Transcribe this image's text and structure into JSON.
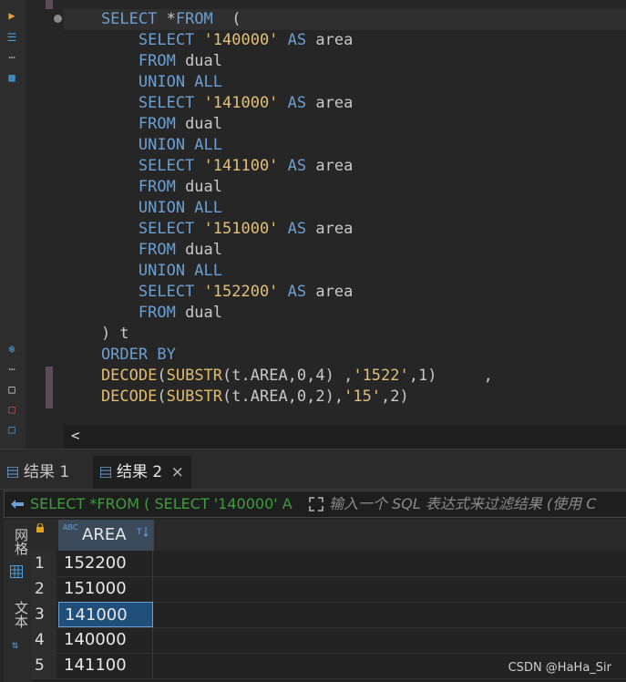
{
  "editor": {
    "lines": [
      [
        {
          "c": "kw",
          "t": "    SELECT "
        },
        {
          "c": "id",
          "t": "*"
        },
        {
          "c": "kw",
          "t": "FROM"
        },
        {
          "c": "id",
          "t": "  ("
        }
      ],
      [
        {
          "c": "kw",
          "t": "        SELECT "
        },
        {
          "c": "str",
          "t": "'140000'"
        },
        {
          "c": "kw",
          "t": " AS "
        },
        {
          "c": "id",
          "t": "area"
        }
      ],
      [
        {
          "c": "kw",
          "t": "        FROM "
        },
        {
          "c": "id",
          "t": "dual"
        }
      ],
      [
        {
          "c": "kw",
          "t": "        UNION ALL"
        }
      ],
      [
        {
          "c": "kw",
          "t": "        SELECT "
        },
        {
          "c": "str",
          "t": "'141000'"
        },
        {
          "c": "kw",
          "t": " AS "
        },
        {
          "c": "id",
          "t": "area"
        }
      ],
      [
        {
          "c": "kw",
          "t": "        FROM "
        },
        {
          "c": "id",
          "t": "dual"
        }
      ],
      [
        {
          "c": "kw",
          "t": "        UNION ALL"
        }
      ],
      [
        {
          "c": "kw",
          "t": "        SELECT "
        },
        {
          "c": "str",
          "t": "'141100'"
        },
        {
          "c": "kw",
          "t": " AS "
        },
        {
          "c": "id",
          "t": "area"
        }
      ],
      [
        {
          "c": "kw",
          "t": "        FROM "
        },
        {
          "c": "id",
          "t": "dual"
        }
      ],
      [
        {
          "c": "kw",
          "t": "        UNION ALL"
        }
      ],
      [
        {
          "c": "kw",
          "t": "        SELECT "
        },
        {
          "c": "str",
          "t": "'151000'"
        },
        {
          "c": "kw",
          "t": " AS "
        },
        {
          "c": "id",
          "t": "area"
        }
      ],
      [
        {
          "c": "kw",
          "t": "        FROM "
        },
        {
          "c": "id",
          "t": "dual"
        }
      ],
      [
        {
          "c": "kw",
          "t": "        UNION ALL"
        }
      ],
      [
        {
          "c": "kw",
          "t": "        SELECT "
        },
        {
          "c": "str",
          "t": "'152200'"
        },
        {
          "c": "kw",
          "t": " AS "
        },
        {
          "c": "id",
          "t": "area"
        }
      ],
      [
        {
          "c": "kw",
          "t": "        FROM "
        },
        {
          "c": "id",
          "t": "dual"
        }
      ],
      [
        {
          "c": "id",
          "t": "    ) t"
        }
      ],
      [
        {
          "c": "kw",
          "t": "    ORDER BY"
        }
      ],
      [
        {
          "c": "fn",
          "t": "    DECODE"
        },
        {
          "c": "id",
          "t": "("
        },
        {
          "c": "fn",
          "t": "SUBSTR"
        },
        {
          "c": "id",
          "t": "(t.AREA,0,4) ,"
        },
        {
          "c": "str",
          "t": "'1522'"
        },
        {
          "c": "id",
          "t": ",1)     ,"
        }
      ],
      [
        {
          "c": "fn",
          "t": "    DECODE"
        },
        {
          "c": "id",
          "t": "("
        },
        {
          "c": "fn",
          "t": "SUBSTR"
        },
        {
          "c": "id",
          "t": "(t.AREA,0,2),"
        },
        {
          "c": "str",
          "t": "'15'"
        },
        {
          "c": "id",
          "t": ",2)"
        }
      ]
    ],
    "hscroll_arrow": "<"
  },
  "results": {
    "tabs": [
      {
        "label": "结果 1",
        "active": false
      },
      {
        "label": "结果 2",
        "active": true,
        "close": "×"
      }
    ],
    "filter_query": "SELECT *FROM ( SELECT '140000' A",
    "filter_placeholder": "输入一个 SQL 表达式来过滤结果 (使用 C",
    "side_tabs": [
      "网格",
      "文本"
    ],
    "column": "AREA",
    "rows": [
      {
        "n": "1",
        "v": "152200"
      },
      {
        "n": "2",
        "v": "151000"
      },
      {
        "n": "3",
        "v": "141000",
        "selected": true
      },
      {
        "n": "4",
        "v": "140000"
      },
      {
        "n": "5",
        "v": "141100"
      }
    ]
  },
  "watermark": "CSDN @HaHa_Sir",
  "colors": {
    "keyword": "#6c9fd2",
    "string": "#e0c07a",
    "selection": "#1f4f7a"
  }
}
